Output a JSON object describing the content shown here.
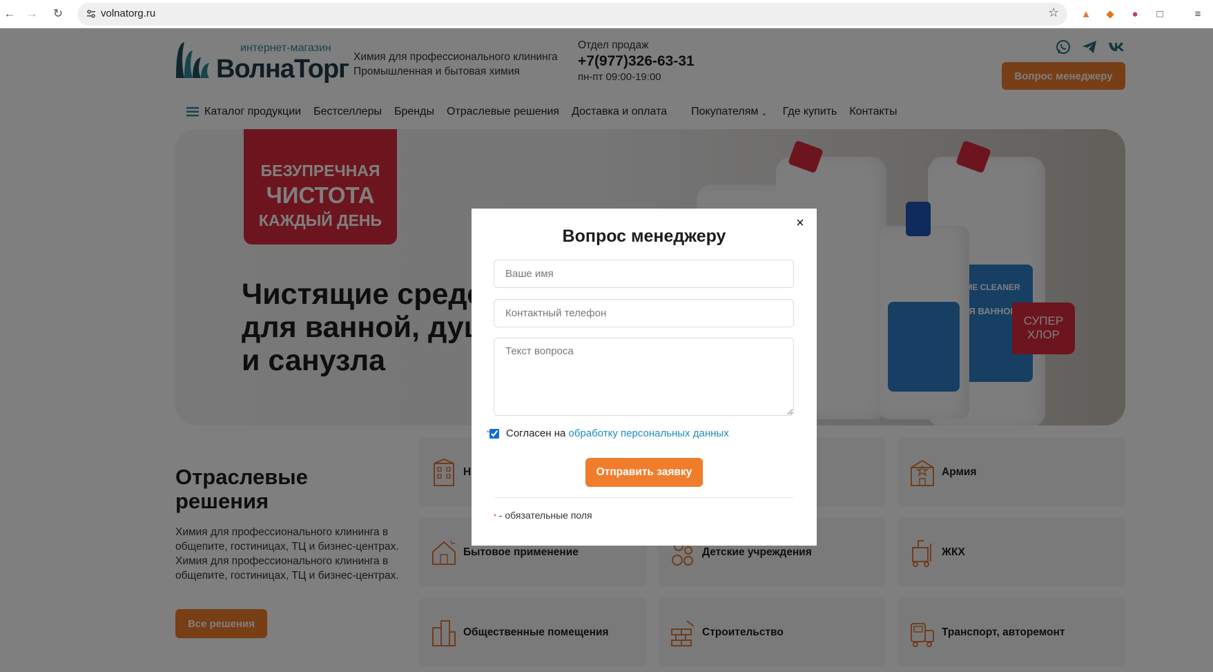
{
  "browser": {
    "url": "volnatorg.ru"
  },
  "header": {
    "logo_small": "интернет-магазин",
    "logo_big": "ВолнаТорг",
    "tagline_line1": "Химия для профессионального клининга",
    "tagline_line2": "Промышленная и бытовая химия",
    "sales_label": "Отдел продаж",
    "sales_phone": "+7(977)326-63-31",
    "sales_hours": "пн-пт 09:00-19:00",
    "manager_button": "Вопрос менеджеру",
    "social": [
      "whatsapp-icon",
      "telegram-icon",
      "vk-icon"
    ]
  },
  "nav": {
    "items": [
      {
        "label": "Каталог продукции"
      },
      {
        "label": "Бестселлеры"
      },
      {
        "label": "Бренды"
      },
      {
        "label": "Отраслевые решения"
      },
      {
        "label": "Доставка и оплата"
      },
      {
        "label": "Покупателям"
      },
      {
        "label": "Где купить"
      },
      {
        "label": "Контакты"
      }
    ]
  },
  "hero": {
    "badge_line1": "БЕЗУПРЕЧНАЯ",
    "badge_line2": "ЧИСТОТА",
    "badge_line3": "КАЖДЫЙ ДЕНЬ",
    "title_line1": "Чистящие средс",
    "title_line2": "для ванной, душ",
    "title_line3": "и санузла",
    "tag_line1": "СУПЕР",
    "tag_line2": "ХЛОР",
    "product_brand": "HOME CLEANER",
    "product_label": "ДЛЯ ВАННОЙ"
  },
  "solutions": {
    "title_line1": "Отраслевые",
    "title_line2": "решения",
    "description": "Химия для профессионального клининга в общепите, гостиницах, ТЦ и бизнес-центрах. Химия для профессионального клининга в общепите, гостиницах, ТЦ и бизнес-центрах.",
    "all_button": "Все решения",
    "cards": [
      {
        "label": "Н",
        "icon": "building-icon"
      },
      {
        "label": "Армия",
        "icon": "army-building-icon"
      },
      {
        "label": "Бытовое применение",
        "icon": "house-icon"
      },
      {
        "label": "Детские учреждения",
        "icon": "kids-icon"
      },
      {
        "label": "ЖКХ",
        "icon": "cleaning-cart-icon"
      },
      {
        "label": "Общественные помещения",
        "icon": "city-buildings-icon"
      },
      {
        "label": "Строительство",
        "icon": "bricks-icon"
      },
      {
        "label": "Транспорт, авторемонт",
        "icon": "transport-icon"
      }
    ]
  },
  "modal": {
    "title": "Вопрос менеджеру",
    "close": "×",
    "name_placeholder": "Ваше имя",
    "phone_placeholder": "Контактный телефон",
    "message_placeholder": "Текст вопроса",
    "consent_text": "Согласен на",
    "consent_link": "обработку персональных данных",
    "consent_checked": true,
    "submit": "Отправить заявку",
    "required_mark": "*",
    "required_note": "- обязательные поля"
  },
  "colors": {
    "accent": "#f07d2c",
    "brand_dark": "#1f4e5f",
    "brand_teal": "#2a8a9a",
    "badge_red": "#d82a3c",
    "link": "#1d8bc0"
  }
}
